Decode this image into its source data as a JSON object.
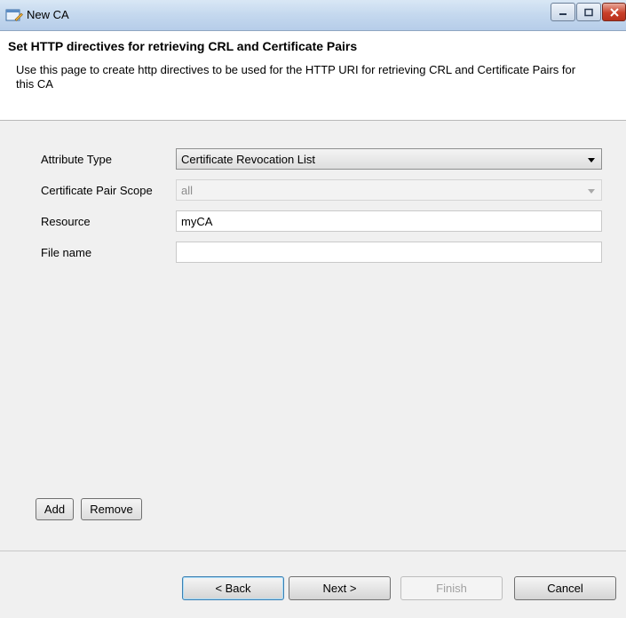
{
  "window": {
    "title": "New CA",
    "minimize_icon": "minimize-icon",
    "maximize_icon": "maximize-icon",
    "close_icon": "close-icon"
  },
  "header": {
    "title": "Set HTTP directives for retrieving CRL and Certificate Pairs",
    "description": "Use this page to create http directives to be used for the HTTP URI for retrieving CRL and Certificate Pairs for this CA"
  },
  "form": {
    "attribute_type": {
      "label": "Attribute Type",
      "value": "Certificate Revocation List"
    },
    "pair_scope": {
      "label": "Certificate Pair Scope",
      "value": "all"
    },
    "resource": {
      "label": "Resource",
      "value": "myCA"
    },
    "file_name": {
      "label": "File name",
      "value": ""
    }
  },
  "actions": {
    "add": "Add",
    "remove": "Remove"
  },
  "footer": {
    "back": "< Back",
    "next": "Next >",
    "finish": "Finish",
    "cancel": "Cancel"
  }
}
